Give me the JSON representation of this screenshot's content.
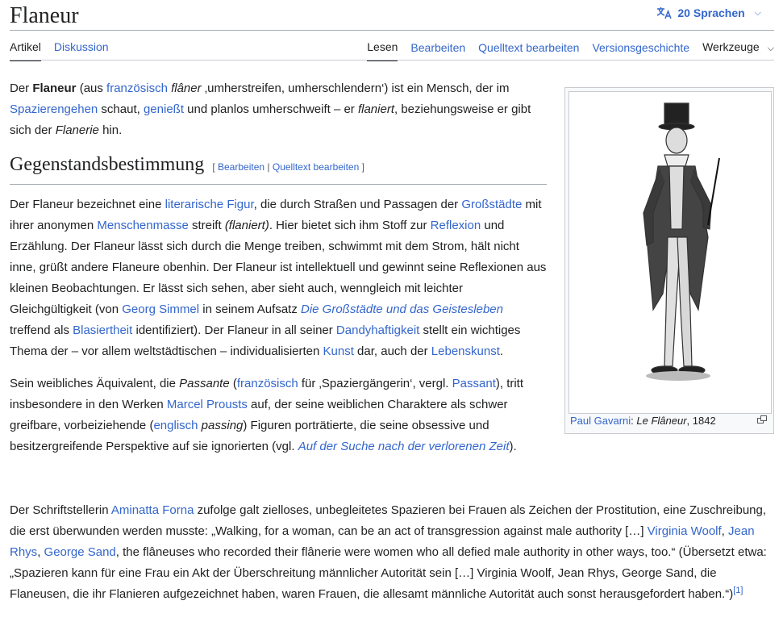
{
  "title": "Flaneur",
  "languages_button": "20 Sprachen",
  "tabs_left": [
    "Artikel",
    "Diskussion"
  ],
  "tabs_right": [
    "Lesen",
    "Bearbeiten",
    "Quelltext bearbeiten",
    "Versionsgeschichte",
    "Werkzeuge"
  ],
  "intro": {
    "t1": "Der ",
    "b1": "Flaneur",
    "t2": " (aus ",
    "l1": "französisch",
    "i1": "flâner",
    "t3": " ‚umherstreifen, umherschlendern‘) ist ein Mensch, der im ",
    "l2": "Spazierengehen",
    "t4": " schaut, ",
    "l3": "genießt",
    "t5": " und planlos umherschweift – er ",
    "i2": "flaniert",
    "t6": ", beziehungsweise er gibt sich der ",
    "i3": "Flanerie",
    "t7": " hin."
  },
  "section": {
    "heading": "Gegenstandsbestimmung",
    "edit_open": "[",
    "edit1": "Bearbeiten",
    "edit_sep": "|",
    "edit2": "Quelltext bearbeiten",
    "edit_close": "]"
  },
  "p1": {
    "t1": "Der Flaneur bezeichnet eine ",
    "l1": "literarische Figur",
    "t2": ", die durch Straßen und Passagen der ",
    "l2": "Großstädte",
    "t3": " mit ihrer anonymen ",
    "l3": "Menschenmasse",
    "t4": " streift ",
    "i1": "(flaniert)",
    "t5": ". Hier bietet sich ihm Stoff zur ",
    "l4": "Reflexion",
    "t6": " und Erzählung. Der Flaneur lässt sich durch die Menge treiben, schwimmt mit dem Strom, hält nicht inne, grüßt andere Flaneure obenhin. Der Flaneur ist intellektuell und gewinnt seine Reflexionen aus kleinen Beobachtungen. Er lässt sich sehen, aber sieht auch, wenngleich mit leichter Gleichgültigkeit (von ",
    "l5": "Georg Simmel",
    "t7": " in seinem Aufsatz ",
    "l6": "Die Großstädte und das Geistesleben",
    "t8": " treffend als ",
    "l7": "Blasiertheit",
    "t9": " identifiziert). Der Flaneur in all seiner ",
    "l8": "Dandyhaftigkeit",
    "t10": " stellt ein wichtiges Thema der – vor allem weltstädtischen – individualisierten ",
    "l9": "Kunst",
    "t11": " dar, auch der ",
    "l10": "Lebenskunst",
    "t12": "."
  },
  "p2": {
    "t1": "Sein weibliches Äquivalent, die ",
    "i1": "Passante",
    "t2": " (",
    "l1": "französisch",
    "t3": " für ‚Spaziergängerin‘, vergl. ",
    "l2": "Passant",
    "t4": "), tritt insbesondere in den Werken ",
    "l3": "Marcel Prousts",
    "t5": " auf, der seine weiblichen Charaktere als schwer greifbare, vorbeiziehende (",
    "l4": "englisch",
    "i2": "passing",
    "t6": ") Figuren porträtierte, die seine obsessive und besitzergreifende Perspektive auf sie ignorierten (vgl. ",
    "l5": "Auf der Suche nach der verlorenen Zeit",
    "t7": ")."
  },
  "p3": {
    "t1": "Der Schriftstellerin ",
    "l1": "Aminatta Forna",
    "t2": " zufolge galt zielloses, unbegleitetes Spazieren bei Frauen als Zeichen der Prostitution, eine Zuschreibung, die erst überwunden werden musste: „Walking, for a woman, can be an act of transgression against male authority […] ",
    "l2": "Virginia Woolf",
    "t3": ", ",
    "l3": "Jean Rhys",
    "t4": ", ",
    "l4": "George Sand",
    "t5": ", the flâneuses who recorded their flânerie were women who all defied male authority in other ways, too.“ (Übersetzt etwa: „Spazieren kann für eine Frau ein Akt der Überschreitung männlicher Autorität sein […] Virginia Woolf, Jean Rhys, George Sand, die Flaneusen, die ihr Flanieren aufgezeichnet haben, waren Frauen, die allesamt männliche Autorität auch sonst herausgefordert haben.“)",
    "ref": "[1]"
  },
  "image": {
    "caption_link": "Paul Gavarni",
    "caption_sep": ": ",
    "caption_title": "Le Flâneur",
    "caption_year": ", 1842"
  }
}
